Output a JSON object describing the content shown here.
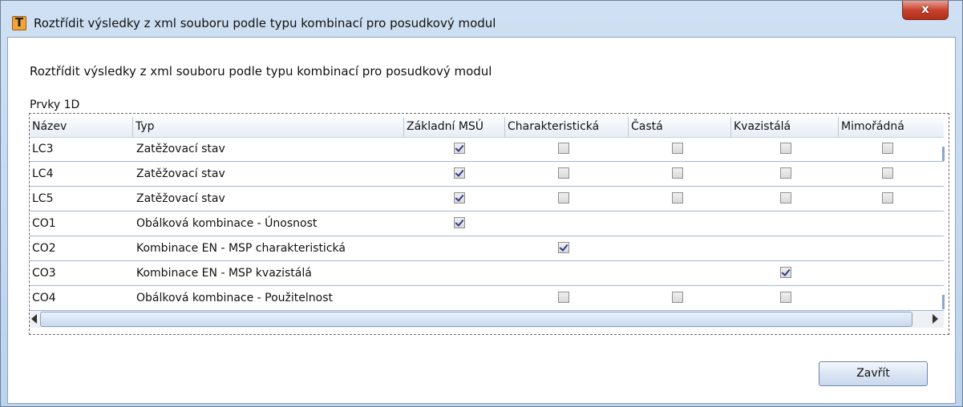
{
  "window": {
    "title": "Roztřídit výsledky z xml souboru podle typu kombinací pro posudkový modul",
    "icon_letter": "T",
    "close_glyph": "x"
  },
  "dialog": {
    "description": "Roztřídit výsledky z xml souboru podle typu kombinací pro posudkový modul",
    "group_label": "Prvky 1D",
    "close_button": "Zavřít"
  },
  "grid": {
    "columns": [
      "Název",
      "Typ",
      "Základní MSÚ",
      "Charakteristická",
      "Častá",
      "Kvazistálá",
      "Mimořádná"
    ],
    "rows": [
      {
        "name": "LC3",
        "type": "Zatěžovací stav",
        "checks": [
          true,
          false,
          false,
          false,
          false
        ]
      },
      {
        "name": "LC4",
        "type": "Zatěžovací stav",
        "checks": [
          true,
          false,
          false,
          false,
          false
        ]
      },
      {
        "name": "LC5",
        "type": "Zatěžovací stav",
        "checks": [
          true,
          false,
          false,
          false,
          false
        ]
      },
      {
        "name": "CO1",
        "type": "Obálková kombinace - Únosnost",
        "checks": [
          true,
          null,
          null,
          null,
          null
        ]
      },
      {
        "name": "CO2",
        "type": "Kombinace EN - MSP charakteristická",
        "checks": [
          null,
          true,
          null,
          null,
          null
        ]
      },
      {
        "name": "CO3",
        "type": "Kombinace EN - MSP kvazistálá",
        "checks": [
          null,
          null,
          null,
          true,
          null
        ]
      },
      {
        "name": "CO4",
        "type": "Obálková kombinace - Použitelnost",
        "checks": [
          null,
          false,
          false,
          false,
          null
        ]
      }
    ]
  }
}
